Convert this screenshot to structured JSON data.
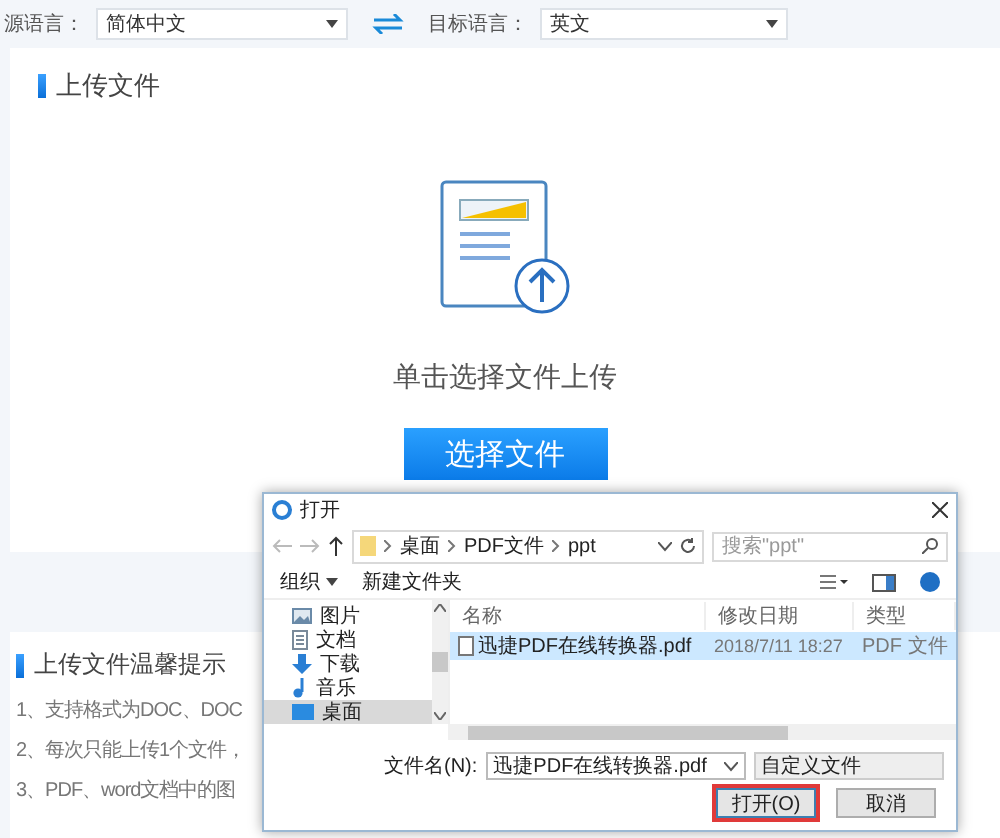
{
  "top_bar": {
    "source_label": "源语言：",
    "source_value": "简体中文",
    "target_label": "目标语言：",
    "target_value": "英文"
  },
  "upload": {
    "title": "上传文件",
    "hint": "单击选择文件上传",
    "button": "选择文件"
  },
  "tips": {
    "title": "上传文件温馨提示",
    "items": [
      "1、支持格式为DOC、DOC",
      "2、每次只能上传1个文件，",
      "3、PDF、word文档中的图"
    ]
  },
  "dialog": {
    "title": "打开",
    "path": [
      "桌面",
      "PDF文件",
      "ppt"
    ],
    "search_placeholder": "搜索\"ppt\"",
    "organize": "组织",
    "new_folder": "新建文件夹",
    "nav_items": [
      {
        "label": "图片",
        "kind": "pictures",
        "selected": false
      },
      {
        "label": "文档",
        "kind": "documents",
        "selected": false
      },
      {
        "label": "下载",
        "kind": "downloads",
        "selected": false
      },
      {
        "label": "音乐",
        "kind": "music",
        "selected": false
      },
      {
        "label": "桌面",
        "kind": "desktop",
        "selected": true
      }
    ],
    "columns": [
      "名称",
      "修改日期",
      "类型"
    ],
    "files": [
      {
        "name": "迅捷PDF在线转换器.pdf",
        "date": "2018/7/11 18:27",
        "type": "PDF 文件",
        "selected": true
      }
    ],
    "filename_label": "文件名(N):",
    "filename_value": "迅捷PDF在线转换器.pdf",
    "filter": "自定义文件",
    "buttons": [
      {
        "label": "打开(O)",
        "kind": "primary"
      },
      {
        "label": "取消",
        "kind": "default"
      }
    ]
  }
}
